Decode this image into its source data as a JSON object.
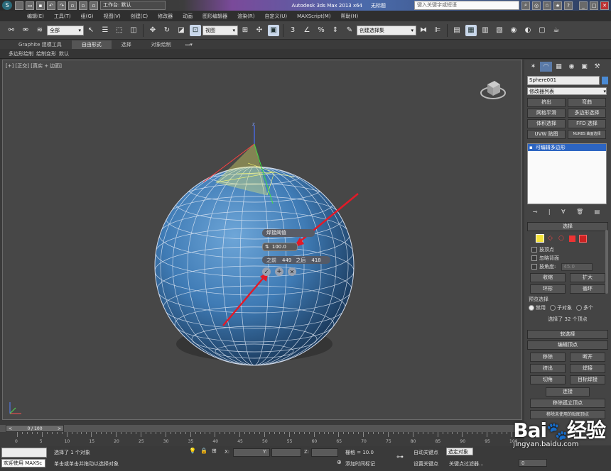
{
  "titlebar": {
    "workspace_label": "工作台: 默认",
    "app_title": "Autodesk 3ds Max  2013 x64",
    "file_name": "无标题",
    "search_placeholder": "键入关键字或短语"
  },
  "menu": [
    "编辑(E)",
    "工具(T)",
    "组(G)",
    "视图(V)",
    "创建(C)",
    "修改器",
    "动画",
    "图形编辑器",
    "渲染(R)",
    "自定义(U)",
    "MAXScript(M)",
    "帮助(H)"
  ],
  "toolbar": {
    "selection_filter": "全部",
    "ref_coord": "视图",
    "named_selection": "创建选择集"
  },
  "ribbon": {
    "tabs": [
      "Graphite 建模工具",
      "自由形式",
      "选择",
      "对象绘制"
    ],
    "active_tab_index": 1,
    "sub_items": [
      "多边形绘制",
      "绘制变形",
      "默认"
    ]
  },
  "viewport": {
    "label": "[+] [正交] [真实 + 边面]"
  },
  "caddy": {
    "title": "焊接阈值",
    "value": "100.0",
    "before_label": "之前",
    "before_value": "449",
    "after_label": "之后",
    "after_value": "418"
  },
  "panel": {
    "object_name": "Sphere001",
    "modifier_list": "修改器列表",
    "mod_buttons": [
      "挤出",
      "弯曲",
      "网格平滑",
      "多边形选择",
      "体积选择",
      "FFD 选择",
      "UVW 贴图",
      "NURBS 曲面选择"
    ],
    "stack_item": "可编辑多边形",
    "selection_header": "选择",
    "by_vertex": "按顶点",
    "ignore_backfacing": "忽略背面",
    "by_angle": "按角度:",
    "angle_value": "45.0",
    "shrink": "收缩",
    "grow": "扩大",
    "ring": "环形",
    "loop": "循环",
    "preview_label": "预览选择",
    "preview_opts": [
      "禁用",
      "子对象",
      "多个"
    ],
    "status_text": "选择了 32 个顶点",
    "soft_sel": "软选择",
    "edit_vertices": "编辑顶点",
    "remove": "移除",
    "break": "断开",
    "extrude": "挤出",
    "weld": "焊接",
    "chamfer": "切角",
    "target_weld": "目标焊接",
    "connect": "连接",
    "remove_isolated": "移除孤立顶点",
    "remove_unused_map": "移除未使用的贴图顶点"
  },
  "timeline": {
    "frame_display": "0 / 100",
    "ticks": [
      "0",
      "5",
      "10",
      "15",
      "20",
      "25",
      "30",
      "35",
      "40",
      "45",
      "50",
      "55",
      "60",
      "65",
      "70",
      "75",
      "80",
      "85",
      "90",
      "95",
      "100"
    ]
  },
  "status": {
    "welcome": "欢迎使用 MAXSc",
    "selected": "选择了 1 个对象",
    "prompt": "单击或单击并拖动以选择对象",
    "x_label": "X:",
    "y_label": "Y:",
    "z_label": "Z:",
    "grid": "栅格 = 10.0",
    "add_time_tag": "添加时间标记",
    "auto_key": "自动关键点",
    "selected_obj": "选定对象",
    "set_key": "设置关键点",
    "key_filters": "关键点过滤器...",
    "frame_value": "0"
  },
  "watermark": {
    "brand": "Bai",
    "brand2": "经验",
    "url": "jingyan.baidu.com"
  }
}
